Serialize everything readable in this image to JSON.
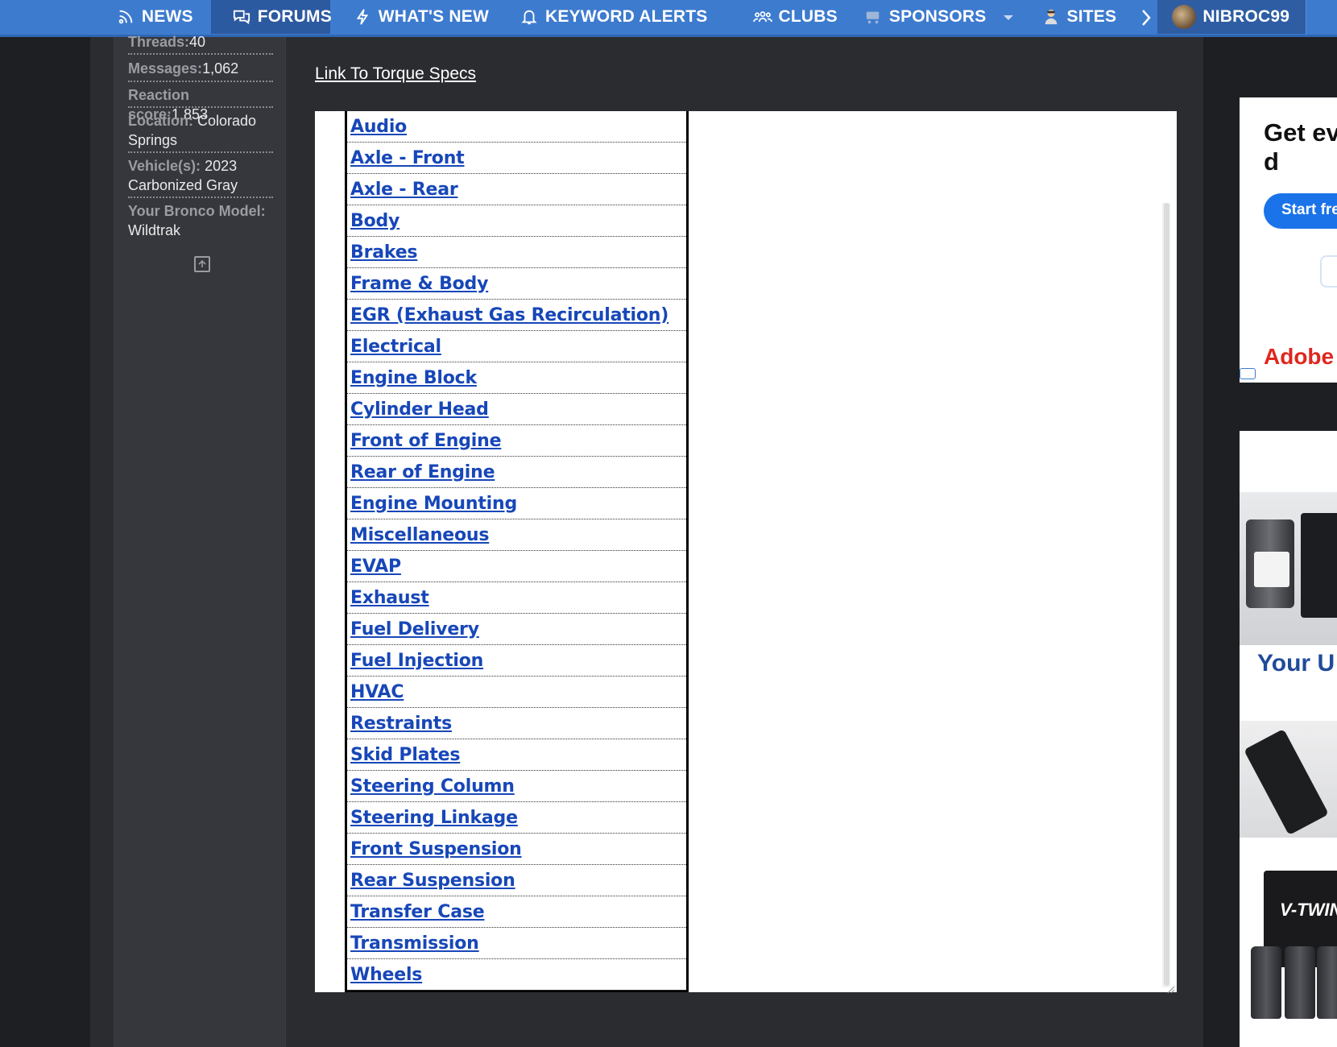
{
  "nav": {
    "items": [
      {
        "label": "NEWS",
        "icon": "news-icon"
      },
      {
        "label": "FORUMS",
        "icon": "chat-bubbles-icon"
      },
      {
        "label": "WHAT'S NEW",
        "icon": "bolt-icon"
      },
      {
        "label": "KEYWORD ALERTS",
        "icon": "bell-icon"
      },
      {
        "label": "CLUBS",
        "icon": "users-icon"
      },
      {
        "label": "SPONSORS",
        "icon": "cart-icon"
      },
      {
        "label": "SITES",
        "icon": "person-icon"
      }
    ],
    "active": "FORUMS",
    "user": "NIBROC99"
  },
  "sidebar": {
    "threads_label": "Threads:",
    "threads_value": "40",
    "messages_label": "Messages:",
    "messages_value": "1,062",
    "reaction_label": "Reaction score:",
    "reaction_value": "1,853",
    "location_label": "Location:",
    "location_value": "Colorado Springs",
    "vehicle_label": "Vehicle(s):",
    "vehicle_value": "2023 Carbonized Gray",
    "model_label": "Your Bronco Model:",
    "model_value": "Wildtrak"
  },
  "post": {
    "link_text": "Link To Torque Specs",
    "categories": [
      "Audio",
      "Axle - Front",
      "Axle - Rear",
      "Body",
      "Brakes",
      "Frame & Body",
      "EGR (Exhaust Gas Recirculation)",
      "Electrical",
      "Engine Block",
      "Cylinder Head",
      "Front of Engine",
      "Rear of Engine",
      "Engine Mounting",
      "Miscellaneous",
      "EVAP",
      "Exhaust",
      "Fuel Delivery",
      "Fuel Injection",
      "HVAC",
      "Restraints",
      "Skid Plates",
      "Steering Column",
      "Steering Linkage",
      "Front Suspension",
      "Rear Suspension",
      "Transfer Case",
      "Transmission",
      "Wheels"
    ]
  },
  "ads": {
    "ad1_headline": "Get ev tasks d",
    "ad1_button": "Start fre",
    "ad1_brand": "Adobe",
    "ad2_text": "Your U",
    "ad2_product": "V-TWIN"
  },
  "colors": {
    "nav_bg": "#3d7bcf",
    "link_blue": "#1747b8",
    "page_bg": "#2a2c30"
  }
}
